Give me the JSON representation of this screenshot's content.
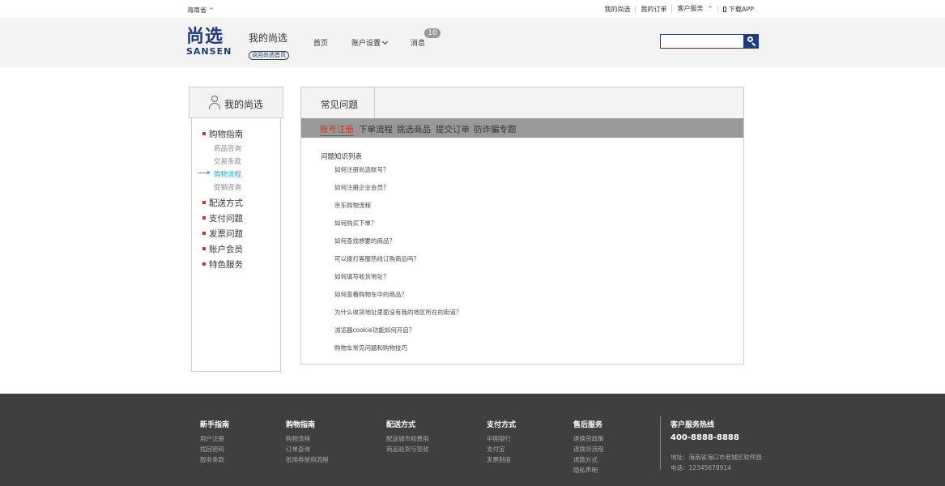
{
  "topbar": {
    "region": "海南省",
    "links": [
      "我的尚选",
      "我的订单",
      "客户服务"
    ],
    "app_link": "下载APP"
  },
  "header": {
    "logo_cn": "尚选",
    "logo_en": "SANSEN",
    "mine_title": "我的尚选",
    "back_home": "返回尚选首页",
    "nav": {
      "home": "首页",
      "account": "账户设置",
      "messages": "消息",
      "message_count": "10"
    },
    "search_placeholder": ""
  },
  "sidebar": {
    "title": "我的尚选",
    "groups": [
      {
        "label": "购物指南",
        "subs": [
          "商品咨询",
          "交易条款",
          "购物流程",
          "促销咨询"
        ],
        "active_sub": "购物流程"
      },
      {
        "label": "配送方式"
      },
      {
        "label": "支付问题"
      },
      {
        "label": "发票问题"
      },
      {
        "label": "账户会员"
      },
      {
        "label": "特色服务"
      }
    ]
  },
  "main": {
    "tab": "常见问题",
    "categories": [
      "账号注册",
      "下单流程",
      "挑选商品",
      "提交订单",
      "防诈骗专题"
    ],
    "active_category": "账号注册",
    "list_title": "问题知识列表",
    "questions": [
      "如何注册尚选账号？",
      "如何注册企业会员？",
      "京东购物流程",
      "如何购买下单？",
      "如何查找想要的商品？",
      "可以拨打客服热线订购商品吗？",
      "如何填写收货地址？",
      "如何查看购物车中的商品？",
      "为什么收货地址里面没有我的地区所在的街道？",
      "浏览器cookie功能如何开启？",
      "购物车常见问题和购物技巧"
    ]
  },
  "footer": {
    "columns": [
      {
        "title": "新手指南",
        "links": [
          "用户注册",
          "找回密码",
          "服务条款"
        ]
      },
      {
        "title": "购物指南",
        "links": [
          "购物流程",
          "订单查询",
          "抵用券使用流程"
        ]
      },
      {
        "title": "配送方式",
        "links": [
          "配送城市和费用",
          "商品验货与签收"
        ]
      },
      {
        "title": "支付方式",
        "links": [
          "中国银行",
          "支付宝",
          "发票制度"
        ]
      },
      {
        "title": "售后服务",
        "links": [
          "退换货政策",
          "退换货流程",
          "退款方式",
          "隐私声明"
        ]
      }
    ],
    "hotline_title": "客户服务热线",
    "hotline_number": "400-8888-8888",
    "address": "地址：海南省海口市老城区软件园",
    "phone": "电话：12345678914"
  },
  "colors": {
    "brand": "#1e3d7a",
    "accent_red": "#c0392b",
    "active_blue": "#1aa7d7",
    "footer_bg": "#3f3f3f"
  }
}
